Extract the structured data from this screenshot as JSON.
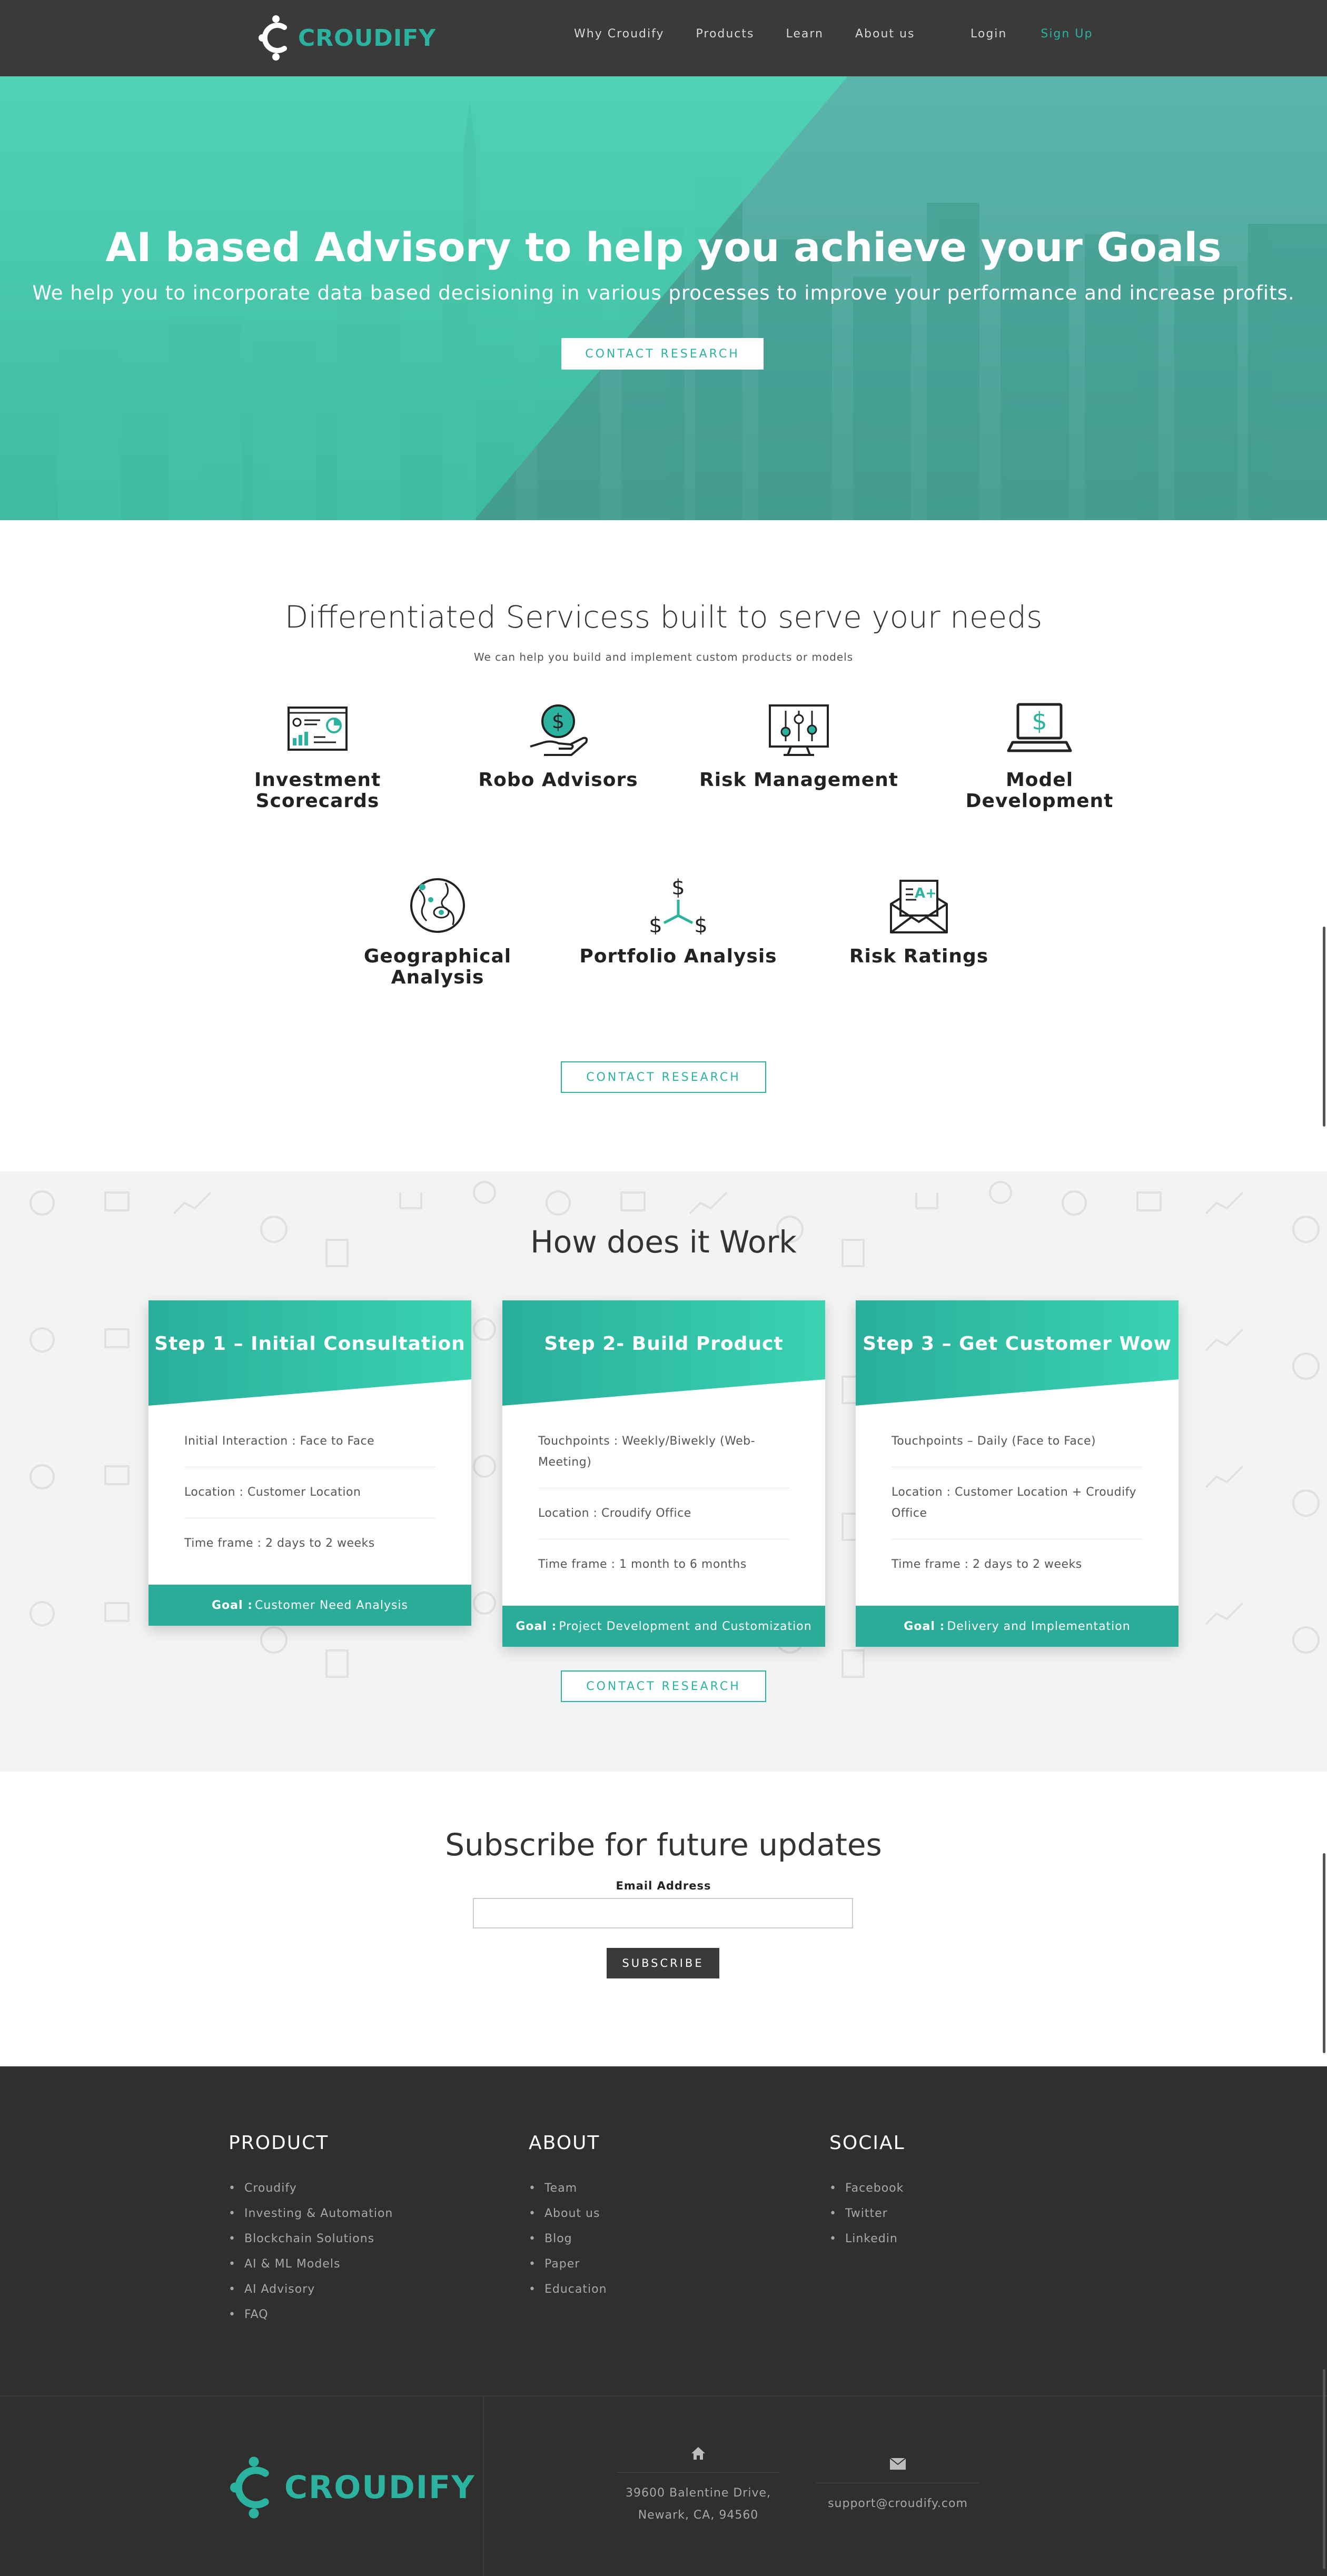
{
  "brand": {
    "name": "CROUDIFY",
    "color": "#2bb3a0"
  },
  "nav": {
    "links": [
      "Why Croudify",
      "Products",
      "Learn",
      "About us"
    ],
    "login": "Login",
    "signup": "Sign Up"
  },
  "hero": {
    "title": "AI based Advisory to help you achieve your Goals",
    "subtitle": "We help you to incorporate data based decisioning in various processes to improve your performance and increase profits.",
    "button": "CONTACT RESEARCH"
  },
  "services": {
    "title": "Differentiated Servicess built to serve your needs",
    "subtitle": "We can help you build and implement custom products or models",
    "items": [
      {
        "line1": "Investment",
        "line2": "Scorecards",
        "icon": "scorecard-icon"
      },
      {
        "line1": "Robo Advisors",
        "line2": "",
        "icon": "robo-advisor-icon"
      },
      {
        "line1": "Risk Management",
        "line2": "",
        "icon": "risk-management-icon"
      },
      {
        "line1": "Model",
        "line2": "Development",
        "icon": "laptop-dollar-icon"
      },
      {
        "line1": "Geographical",
        "line2": "Analysis",
        "icon": "globe-icon"
      },
      {
        "line1": "Portfolio Analysis",
        "line2": "",
        "icon": "portfolio-icon"
      },
      {
        "line1": "Risk Ratings",
        "line2": "",
        "icon": "rating-envelope-icon"
      }
    ],
    "button": "CONTACT RESEARCH"
  },
  "how": {
    "title": "How does it Work",
    "steps": [
      {
        "title": "Step 1 – Initial Consultation",
        "items": [
          "Initial Interaction : Face to Face",
          "Location : Customer Location",
          "Time frame : 2 days to 2 weeks"
        ],
        "goal_label": "Goal :",
        "goal": "Customer Need Analysis"
      },
      {
        "title": "Step 2- Build Product",
        "items": [
          "Touchpoints : Weekly/Biwekly (Web-Meeting)",
          "Location : Croudify Office",
          "Time frame : 1 month to 6 months"
        ],
        "goal_label": "Goal :",
        "goal": "Project Development and Customization"
      },
      {
        "title": "Step 3 – Get Customer Wow",
        "items": [
          "Touchpoints – Daily (Face to Face)",
          "Location : Customer Location + Croudify Office",
          "Time frame : 2 days to 2 weeks"
        ],
        "goal_label": "Goal :",
        "goal": "Delivery and Implementation"
      }
    ],
    "button": "CONTACT RESEARCH"
  },
  "subscribe": {
    "title": "Subscribe for future updates",
    "email_label": "Email Address",
    "email_value": "",
    "button": "SUBSCRIBE"
  },
  "footer": {
    "columns": [
      {
        "title": "PRODUCT",
        "items": [
          "Croudify",
          "Investing & Automation",
          "Blockchain Solutions",
          "AI & ML Models",
          "AI Advisory",
          "FAQ"
        ]
      },
      {
        "title": "ABOUT",
        "items": [
          "Team",
          "About us",
          "Blog",
          "Paper",
          "Education"
        ]
      },
      {
        "title": "SOCIAL",
        "items": [
          "Facebook",
          "Twitter",
          "Linkedin"
        ]
      }
    ],
    "address_line1": "39600 Balentine Drive,",
    "address_line2": "Newark, CA, 94560",
    "email": "support@croudify.com",
    "logo_text": "CROUDIFY"
  }
}
